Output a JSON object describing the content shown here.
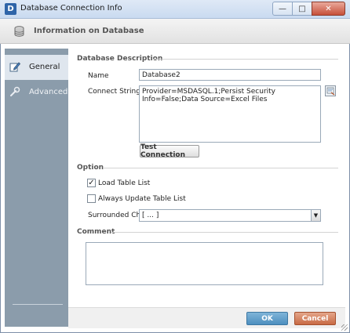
{
  "window": {
    "title": "Database Connection Info",
    "app_icon_letter": "D",
    "minimize_glyph": "—",
    "maximize_glyph": "□",
    "close_glyph": "✕"
  },
  "header": {
    "title": "Information on Database",
    "icon": "database-icon"
  },
  "sidebar": {
    "items": [
      {
        "label": "General",
        "icon": "pencil-icon",
        "active": true
      },
      {
        "label": "Advanced",
        "icon": "wrench-icon",
        "active": false
      }
    ]
  },
  "database_description": {
    "title": "Database Description",
    "name_label": "Name",
    "name_value": "Database2",
    "connect_string_label": "Connect String",
    "connect_string_value": "Provider=MSDASQL.1;Persist Security Info=False;Data Source=Excel Files",
    "test_button": "Test Connection"
  },
  "option": {
    "title": "Option",
    "load_table_list_label": "Load Table List",
    "load_table_list_checked": true,
    "always_update_label": "Always Update Table List",
    "always_update_checked": false,
    "surrounded_char_label": "Surrounded Char",
    "surrounded_char_value": "[ ... ]"
  },
  "comment": {
    "title": "Comment",
    "value": ""
  },
  "footer": {
    "ok_label": "OK",
    "cancel_label": "Cancel"
  },
  "colors": {
    "sidebar_bg": "#8b9cab",
    "ok_bg": "#5d9bc8",
    "cancel_bg": "#d27b57"
  }
}
